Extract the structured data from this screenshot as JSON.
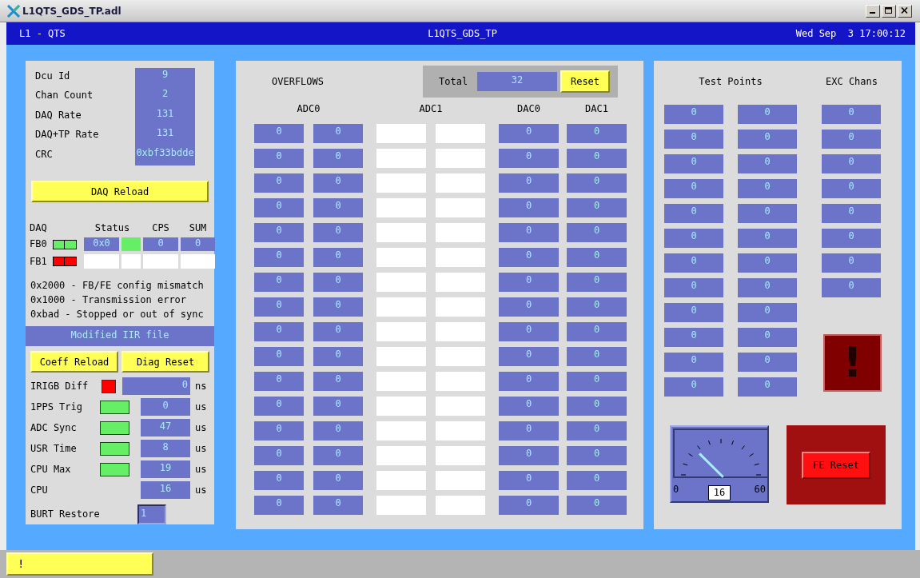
{
  "window": {
    "title": "L1QTS_GDS_TP.adl"
  },
  "header": {
    "left": "L1 - QTS",
    "center": "L1QTS_GDS_TP",
    "right": "Wed Sep  3 17:00:12"
  },
  "info": [
    {
      "label": "Dcu Id",
      "value": "9"
    },
    {
      "label": "Chan Count",
      "value": "2"
    },
    {
      "label": "DAQ Rate",
      "value": "131"
    },
    {
      "label": "DAQ+TP Rate",
      "value": "131"
    },
    {
      "label": "CRC",
      "value": "0xbf33bdde"
    }
  ],
  "daq_reload": "DAQ Reload",
  "daq": {
    "headers": [
      "DAQ",
      "Status",
      "CPS",
      "SUM"
    ],
    "rows": [
      {
        "label": "FB0",
        "color": "#66ee66",
        "connected": true,
        "status": {
          "value": "0x0",
          "color": "#66ee66"
        },
        "cps": "0",
        "sum": "0"
      },
      {
        "label": "FB1",
        "color": "#ff0000",
        "connected": false
      }
    ]
  },
  "legend": [
    "0x2000 - FB/FE config mismatch",
    "0x1000 - Transmission error",
    "0xbad - Stopped or out of sync"
  ],
  "banner": "Modified IIR file",
  "buttons": [
    "Coeff Reload",
    "Diag Reset"
  ],
  "timing": [
    {
      "kind": "wide",
      "label": "IRIGB Diff",
      "color": "#ff0000",
      "value": "0",
      "unit": "ns"
    },
    {
      "kind": "normal",
      "label": "1PPS Trig",
      "color": "#66ee66",
      "value": "0",
      "unit": "us"
    },
    {
      "kind": "normal",
      "label": "ADC Sync",
      "color": "#66ee66",
      "value": "47",
      "unit": "us"
    },
    {
      "kind": "normal",
      "label": "USR Time",
      "color": "#66ee66",
      "value": "8",
      "unit": "us"
    },
    {
      "kind": "normal",
      "label": "CPU Max",
      "color": "#66ee66",
      "value": "19",
      "unit": "us"
    },
    {
      "kind": "normal",
      "label": "CPU",
      "value": "16",
      "unit": "us"
    }
  ],
  "burt": {
    "label": "BURT Restore",
    "value": "1"
  },
  "overflows": {
    "title": "OVERFLOWS",
    "total_label": "Total",
    "total": "32",
    "reset": "Reset",
    "groups": [
      {
        "label": "ADC0",
        "columns": [
          [
            "0",
            "0",
            "0",
            "0",
            "0",
            "0",
            "0",
            "0",
            "0",
            "0",
            "0",
            "0",
            "0",
            "0",
            "0",
            "0"
          ],
          [
            "0",
            "0",
            "0",
            "0",
            "0",
            "0",
            "0",
            "0",
            "0",
            "0",
            "0",
            "0",
            "0",
            "0",
            "0",
            "0"
          ]
        ]
      },
      {
        "label": "ADC1",
        "columns": [
          [
            {
              "connected": false
            },
            {
              "connected": false
            },
            {
              "connected": false
            },
            {
              "connected": false
            },
            {
              "connected": false
            },
            {
              "connected": false
            },
            {
              "connected": false
            },
            {
              "connected": false
            },
            {
              "connected": false
            },
            {
              "connected": false
            },
            {
              "connected": false
            },
            {
              "connected": false
            },
            {
              "connected": false
            },
            {
              "connected": false
            },
            {
              "connected": false
            },
            {
              "connected": false
            }
          ],
          [
            {
              "connected": false
            },
            {
              "connected": false
            },
            {
              "connected": false
            },
            {
              "connected": false
            },
            {
              "connected": false
            },
            {
              "connected": false
            },
            {
              "connected": false
            },
            {
              "connected": false
            },
            {
              "connected": false
            },
            {
              "connected": false
            },
            {
              "connected": false
            },
            {
              "connected": false
            },
            {
              "connected": false
            },
            {
              "connected": false
            },
            {
              "connected": false
            },
            {
              "connected": false
            }
          ]
        ]
      },
      {
        "label": "DAC0",
        "columns": [
          [
            "0",
            "0",
            "0",
            "0",
            "0",
            "0",
            "0",
            "0",
            "0",
            "0",
            "0",
            "0",
            "0",
            "0",
            "0",
            "0"
          ]
        ]
      },
      {
        "label": "DAC1",
        "columns": [
          [
            "0",
            "0",
            "0",
            "0",
            "0",
            "0",
            "0",
            "0",
            "0",
            "0",
            "0",
            "0",
            "0",
            "0",
            "0",
            "0"
          ]
        ]
      }
    ]
  },
  "test_points": {
    "title": "Test Points",
    "columns": [
      [
        "0",
        "0",
        "0",
        "0",
        "0",
        "0",
        "0",
        "0",
        "0",
        "0",
        "0",
        "0"
      ],
      [
        "0",
        "0",
        "0",
        "0",
        "0",
        "0",
        "0",
        "0",
        "0",
        "0",
        "0",
        "0"
      ]
    ]
  },
  "exc_chans": {
    "title": "EXC Chans",
    "values": [
      "0",
      "0",
      "0",
      "0",
      "0",
      "0",
      "0",
      "0"
    ]
  },
  "alarm": {
    "text": "!"
  },
  "meter": {
    "min": "0",
    "max": "60",
    "value": "16"
  },
  "fe_reset": "FE Reset",
  "status_bar": {
    "text": "!"
  }
}
